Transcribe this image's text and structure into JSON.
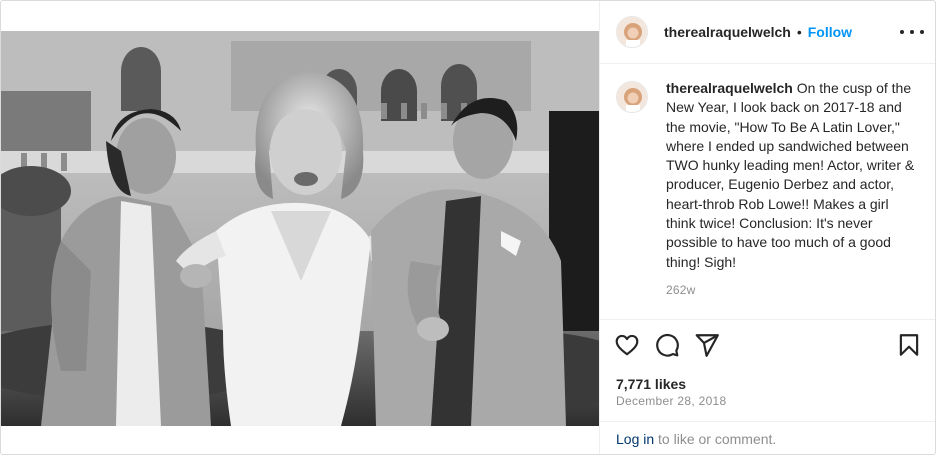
{
  "header": {
    "username": "therealraquelwelch",
    "separator": "•",
    "follow_label": "Follow",
    "more_icon": "more-horizontal-icon"
  },
  "caption": {
    "username": "therealraquelwelch",
    "text": "On the cusp of the New Year, I look back on 2017-18 and the movie, \"How To Be A Latin Lover,\" where I ended up sandwiched between TWO hunky leading men! Actor, writer & producer, Eugenio Derbez and actor, heart-throb Rob Lowe!! Makes a girl think twice!  Conclusion: It's never possible to have too much of a good thing! Sigh!",
    "time_ago": "262w"
  },
  "actions": {
    "like_icon": "heart-icon",
    "comment_icon": "comment-icon",
    "share_icon": "paper-plane-icon",
    "save_icon": "bookmark-icon"
  },
  "stats": {
    "likes": "7,771 likes",
    "date": "December 28, 2018"
  },
  "footer": {
    "login_link": "Log in",
    "login_suffix": " to like or comment."
  },
  "colors": {
    "accent": "#0095f6",
    "link_dark": "#00376b",
    "text": "#262626",
    "muted": "#8e8e8e",
    "border": "#efefef"
  }
}
